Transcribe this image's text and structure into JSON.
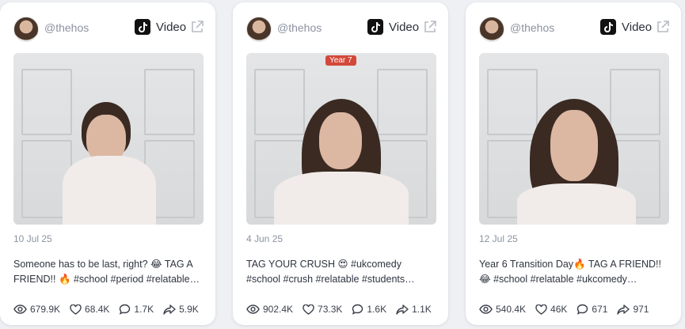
{
  "cards": [
    {
      "handle": "@thehos",
      "platform": "Video",
      "badge": "",
      "date": "10 Jul 25",
      "caption": "Someone has to be last, right? 😂 TAG A FRIEND!! 🔥 #school #period #relatable…",
      "views": "679.9K",
      "likes": "68.4K",
      "comments": "1.7K",
      "shares": "5.9K"
    },
    {
      "handle": "@thehos",
      "platform": "Video",
      "badge": "Year 7",
      "date": "4 Jun 25",
      "caption": "TAG YOUR CRUSH 😍 #ukcomedy #school #crush #relatable #students…",
      "views": "902.4K",
      "likes": "73.3K",
      "comments": "1.6K",
      "shares": "1.1K"
    },
    {
      "handle": "@thehos",
      "platform": "Video",
      "badge": "",
      "date": "12 Jul 25",
      "caption": "Year 6 Transition Day🔥 TAG A FRIEND!! 😂 #school #relatable #ukcomedy…",
      "views": "540.4K",
      "likes": "46K",
      "comments": "671",
      "shares": "971"
    }
  ],
  "icons": {
    "platform": "tiktok-icon",
    "open": "external-link-icon",
    "views": "eye-icon",
    "likes": "heart-icon",
    "comments": "comment-icon",
    "shares": "share-icon"
  }
}
